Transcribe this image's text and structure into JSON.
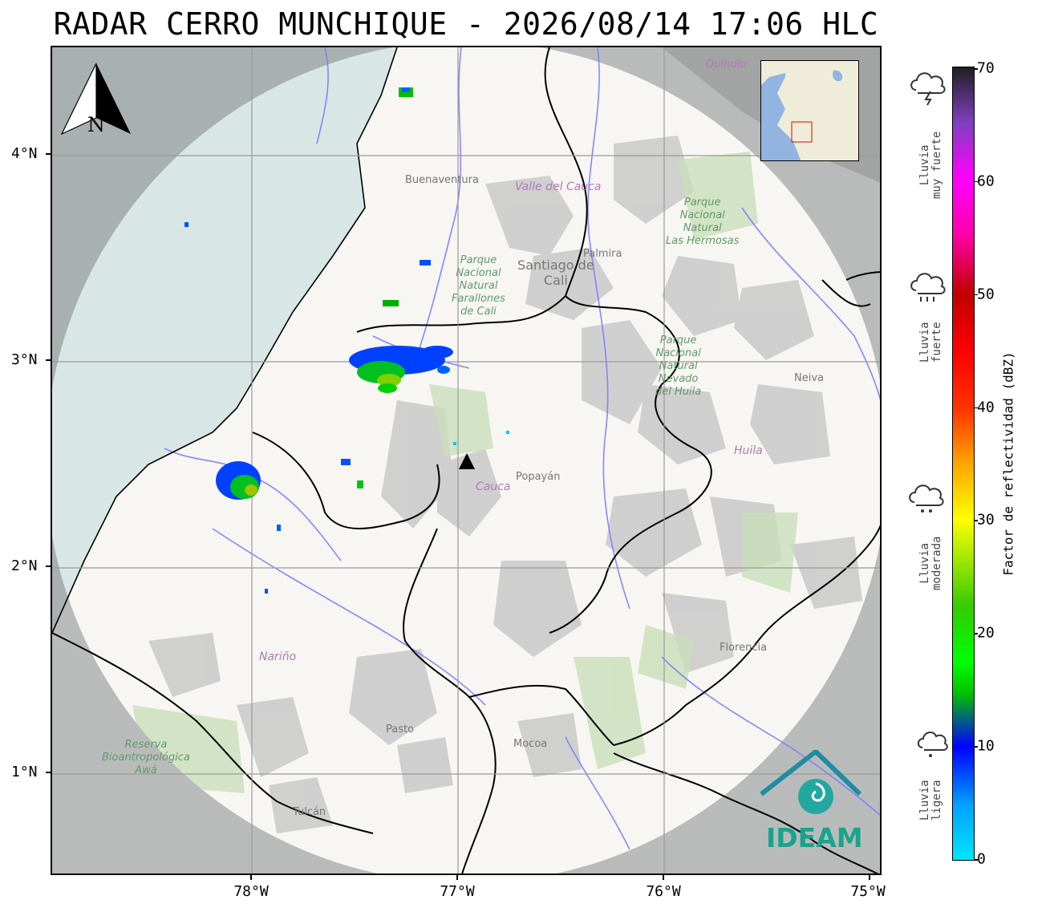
{
  "title": "RADAR CERRO MUNCHIQUE - 2026/08/14 17:06 HLC",
  "north_arrow": {
    "letter": "N"
  },
  "axes": {
    "y_labels": [
      "4°N",
      "3°N",
      "2°N",
      "1°N"
    ],
    "x_labels": [
      "78°W",
      "77°W",
      "76°W",
      "75°W"
    ]
  },
  "place_labels": {
    "buenaventura": "Buenaventura",
    "valle_del_cauca": "Valle del Cauca",
    "farallones": "Parque\nNacional\nNatural\nFarallones\nde Cali",
    "santiago_de_cali": "Santiago de\nCali",
    "palmira": "Palmira",
    "las_hermosas": "Parque\nNacional\nNatural\nLas Hermosas",
    "quindio": "Quindío",
    "nevado_huila": "Parque\nNacional\nNatural\nNevado\ndel Huila",
    "neiva": "Neiva",
    "huila": "Huila",
    "cauca": "Cauca",
    "popayan": "Popayán",
    "narino": "Nariño",
    "florencia": "Florencia",
    "pasto": "Pasto",
    "mocoa": "Mocoa",
    "tulcan": "Tulcán",
    "reserva_awa": "Reserva\nBioantropológica\nAwá"
  },
  "legend": {
    "colorbar_label": "Factor de reflectividad (dBZ)",
    "ticks": [
      "0",
      "10",
      "20",
      "30",
      "40",
      "50",
      "60",
      "70"
    ],
    "vmin": 0,
    "vmax": 70,
    "rain_categories": [
      {
        "label": "Lluvia\nmuy fuerte",
        "icon": "thunderstorm-icon"
      },
      {
        "label": "Lluvia\nfuerte",
        "icon": "heavy-rain-icon"
      },
      {
        "label": "Lluvia\nmoderada",
        "icon": "moderate-rain-icon"
      },
      {
        "label": "Lluvia\nligera",
        "icon": "light-rain-icon"
      }
    ]
  },
  "logo": {
    "text": "IDEAM"
  },
  "colors": {
    "radar_coverage": "#f7f6f2",
    "outside_coverage": "#b9bbbb",
    "ocean": "#c4d9db",
    "department_border": "#000000",
    "rivers": "#7b7bff",
    "logo": "#1aa38c"
  }
}
